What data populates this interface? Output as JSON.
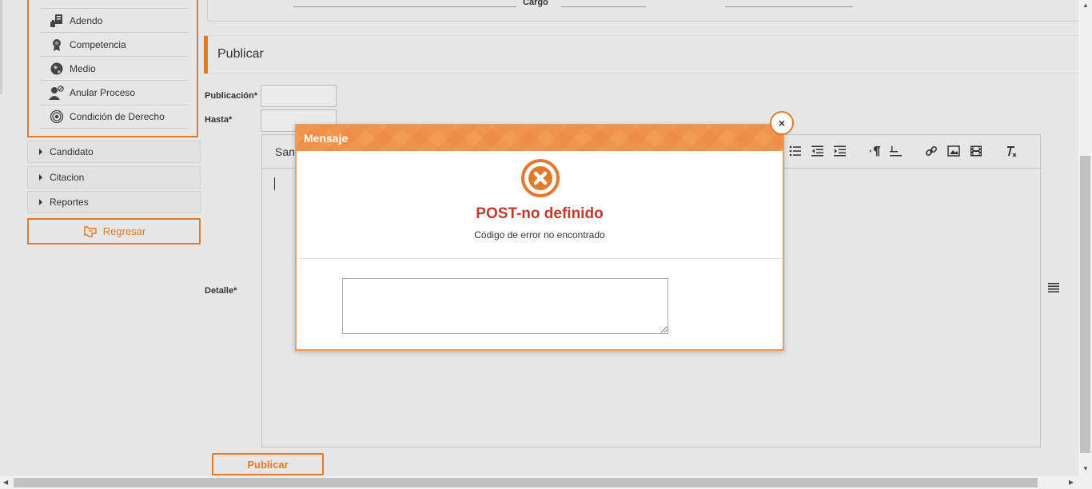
{
  "sidebar": {
    "sub_items": [
      {
        "label": "Adendo",
        "icon": "document-hand-icon"
      },
      {
        "label": "Competencia",
        "icon": "award-icon"
      },
      {
        "label": "Medio",
        "icon": "globe-icon"
      },
      {
        "label": "Anular Proceso",
        "icon": "user-block-icon"
      },
      {
        "label": "Condición de Derecho",
        "icon": "target-icon"
      }
    ],
    "sections": [
      {
        "label": "Candidato"
      },
      {
        "label": "Citacion"
      },
      {
        "label": "Reportes"
      }
    ],
    "back_button": {
      "label": "Regresar",
      "icon": "back-hand-icon"
    }
  },
  "top_form": {
    "cargo_label": "Cargo"
  },
  "publicar": {
    "title": "Publicar",
    "publicacion_label": "Publicación*",
    "hasta_label": "Hasta*",
    "detalle_label": "Detalle*",
    "editor_font": "Sans",
    "submit_label": "Publicar"
  },
  "modal": {
    "title": "Mensaje",
    "error_title": "POST-no definido",
    "error_subtitle": "Código de error no encontrado",
    "textarea_value": "",
    "close_symbol": "×"
  },
  "colors": {
    "accent": "#e07a2e",
    "modal_header": "#f29b55",
    "error_text": "#c0392b"
  }
}
